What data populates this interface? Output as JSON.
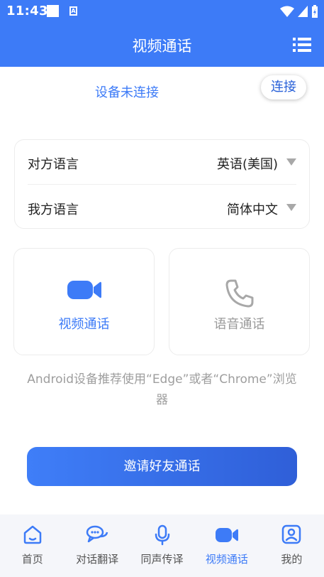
{
  "status_bar": {
    "time": "11:43"
  },
  "app_bar": {
    "title": "视频通话",
    "menu_icon": "list-menu-icon"
  },
  "device": {
    "status": "设备未连接",
    "connect_label": "连接"
  },
  "languages": {
    "other": {
      "label": "对方语言",
      "value": "英语(美国)"
    },
    "mine": {
      "label": "我方语言",
      "value": "简体中文"
    }
  },
  "call_options": {
    "video": {
      "label": "视频通话",
      "icon": "video-camera-icon"
    },
    "voice": {
      "label": "语音通话",
      "icon": "phone-icon"
    }
  },
  "hint": "Android设备推荐使用“Edge”或者“Chrome”浏览器",
  "invite_label": "邀请好友通话",
  "tabs": [
    {
      "label": "首页",
      "icon": "home-icon"
    },
    {
      "label": "对话翻译",
      "icon": "chat-bubbles-icon"
    },
    {
      "label": "同声传译",
      "icon": "microphone-icon"
    },
    {
      "label": "视频通话",
      "icon": "video-camera-icon",
      "active": true
    },
    {
      "label": "我的",
      "icon": "profile-icon"
    }
  ],
  "colors": {
    "primary": "#3d7bf7",
    "inactive_icon": "#a8a8a8",
    "hint_text": "#9e9e9e"
  }
}
